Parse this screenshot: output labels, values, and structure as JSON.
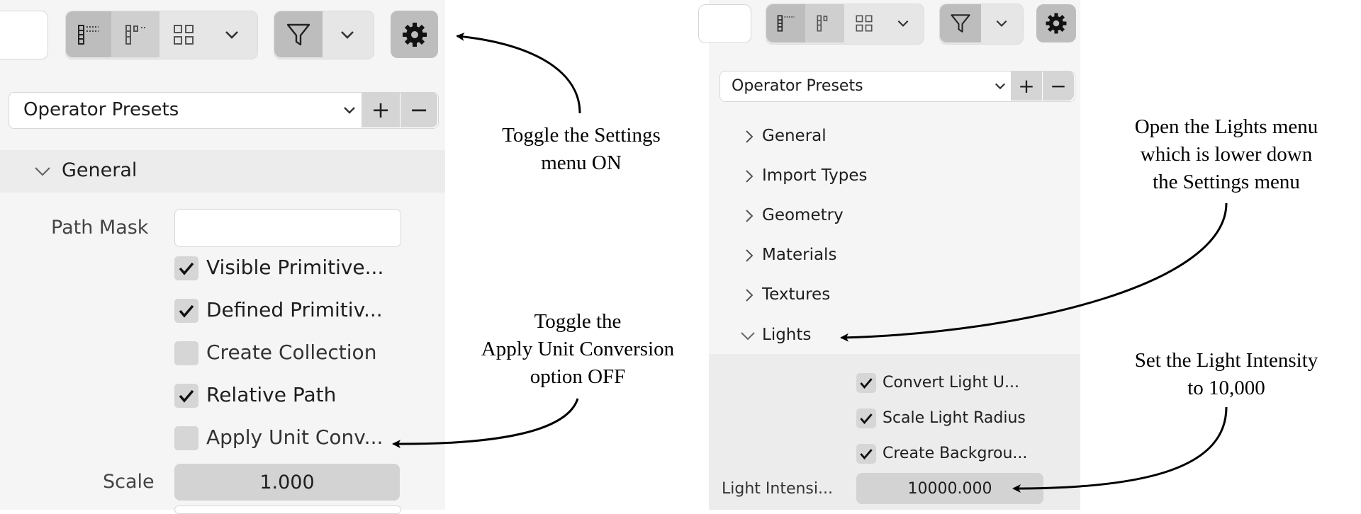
{
  "left": {
    "presets_label": "Operator Presets",
    "plus": "+",
    "minus": "−",
    "general_label": "General",
    "path_mask_label": "Path Mask",
    "path_mask_value": "",
    "options": [
      {
        "label": "Visible Primitive...",
        "checked": true
      },
      {
        "label": "Defined Primitiv...",
        "checked": true
      },
      {
        "label": "Create Collection",
        "checked": false
      },
      {
        "label": "Relative Path",
        "checked": true
      },
      {
        "label": "Apply Unit Conv...",
        "checked": false
      }
    ],
    "scale_label": "Scale",
    "scale_value": "1.000"
  },
  "right": {
    "presets_label": "Operator Presets",
    "plus": "+",
    "minus": "−",
    "sections": [
      "General",
      "Import Types",
      "Geometry",
      "Materials",
      "Textures"
    ],
    "lights_label": "Lights",
    "light_options": [
      {
        "label": "Convert Light U...",
        "checked": true
      },
      {
        "label": "Scale Light Radius",
        "checked": true
      },
      {
        "label": "Create Backgrou...",
        "checked": true
      }
    ],
    "intensity_label": "Light Intensi...",
    "intensity_value": "10000.000"
  },
  "annotations": {
    "settings": [
      "Toggle the Settings",
      "menu ON"
    ],
    "unit": [
      "Toggle the",
      "Apply Unit Conversion",
      "option OFF"
    ],
    "lights": [
      "Open the Lights menu",
      "which is lower down",
      "the Settings menu"
    ],
    "intensity": [
      "Set the Light Intensity",
      "to 10,000"
    ]
  }
}
